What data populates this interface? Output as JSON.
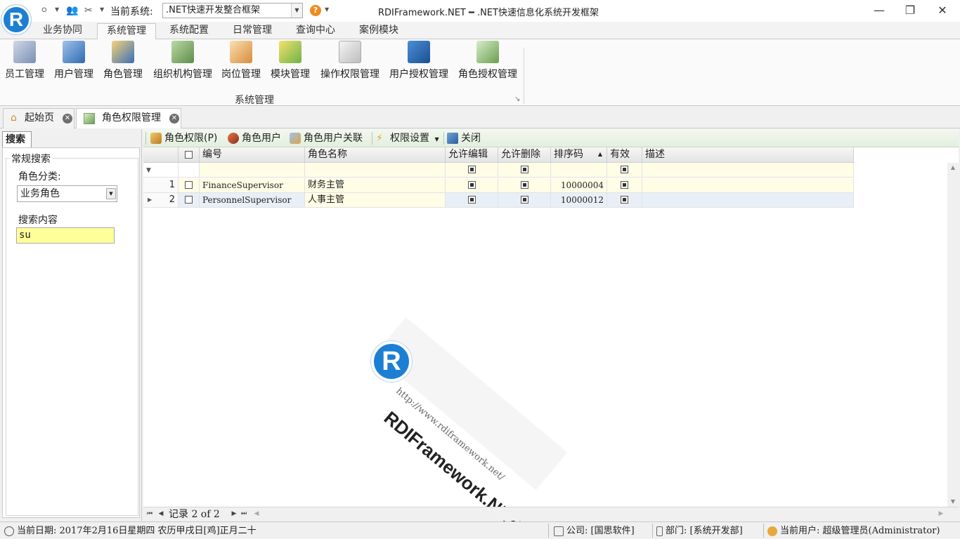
{
  "titlebar": {
    "logo_letter": "R",
    "current_system_label": "当前系统:",
    "current_system_value": ".NET快速开发整合框架",
    "window_title": "RDIFramework.NET ━ .NET快速信息化系统开发框架",
    "help_glyph": "?",
    "minimize": "—",
    "restore": "❐",
    "close": "✕"
  },
  "ribbon_tabs": [
    "业务协同",
    "系统管理",
    "系统配置",
    "日常管理",
    "查询中心",
    "案例模块"
  ],
  "ribbon": {
    "group_label": "系统管理",
    "buttons": [
      {
        "label": "员工管理",
        "icon": "employee-icon"
      },
      {
        "label": "用户管理",
        "icon": "user-icon"
      },
      {
        "label": "角色管理",
        "icon": "role-icon"
      },
      {
        "label": "组织机构管理",
        "icon": "org-icon"
      },
      {
        "label": "岗位管理",
        "icon": "post-icon"
      },
      {
        "label": "模块管理",
        "icon": "module-icon"
      },
      {
        "label": "操作权限管理",
        "icon": "permission-icon"
      },
      {
        "label": "用户授权管理",
        "icon": "user-auth-icon"
      },
      {
        "label": "角色授权管理",
        "icon": "role-auth-icon"
      }
    ]
  },
  "doc_tabs": [
    {
      "label": "起始页",
      "icon": "home-icon"
    },
    {
      "label": "角色权限管理",
      "icon": "role-permission-icon"
    }
  ],
  "search_panel": {
    "tab": "搜索",
    "group_title": "常规搜索",
    "category_label": "角色分类:",
    "category_value": "业务角色",
    "content_label": "搜索内容",
    "content_value": "su"
  },
  "toolbar": {
    "role_permission": "角色权限(P)",
    "role_users": "角色用户",
    "role_user_link": "角色用户关联",
    "permission_settings": "权限设置",
    "close": "关闭"
  },
  "grid": {
    "columns": [
      "编号",
      "角色名称",
      "允许编辑",
      "允许删除",
      "排序码",
      "有效",
      "描述"
    ],
    "rows": [
      {
        "no": "1",
        "code": "FinanceSupervisor",
        "name": "财务主管",
        "allow_edit": true,
        "allow_delete": true,
        "sort": "10000004",
        "enabled": true,
        "desc": ""
      },
      {
        "no": "2",
        "code": "PersonnelSupervisor",
        "name": "人事主管",
        "allow_edit": true,
        "allow_delete": true,
        "sort": "10000012",
        "enabled": true,
        "desc": ""
      }
    ],
    "nav_text": "记录 2 of 2"
  },
  "watermark": {
    "letter": "R",
    "name": "RDIFramework.NET",
    "url": "http://www.rdiframework.net/"
  },
  "statusbar": {
    "date": "当前日期: 2017年2月16日星期四 农历甲戌日[鸡]正月二十",
    "company": "公司: [国思软件]",
    "department": "部门: [系统开发部]",
    "user": "当前用户: 超级管理员(Administrator)"
  },
  "colors": {
    "accent_blue": "#1d7fd4",
    "search_input_bg": "#ffff99",
    "toolbar_green": "#e4efdf"
  }
}
